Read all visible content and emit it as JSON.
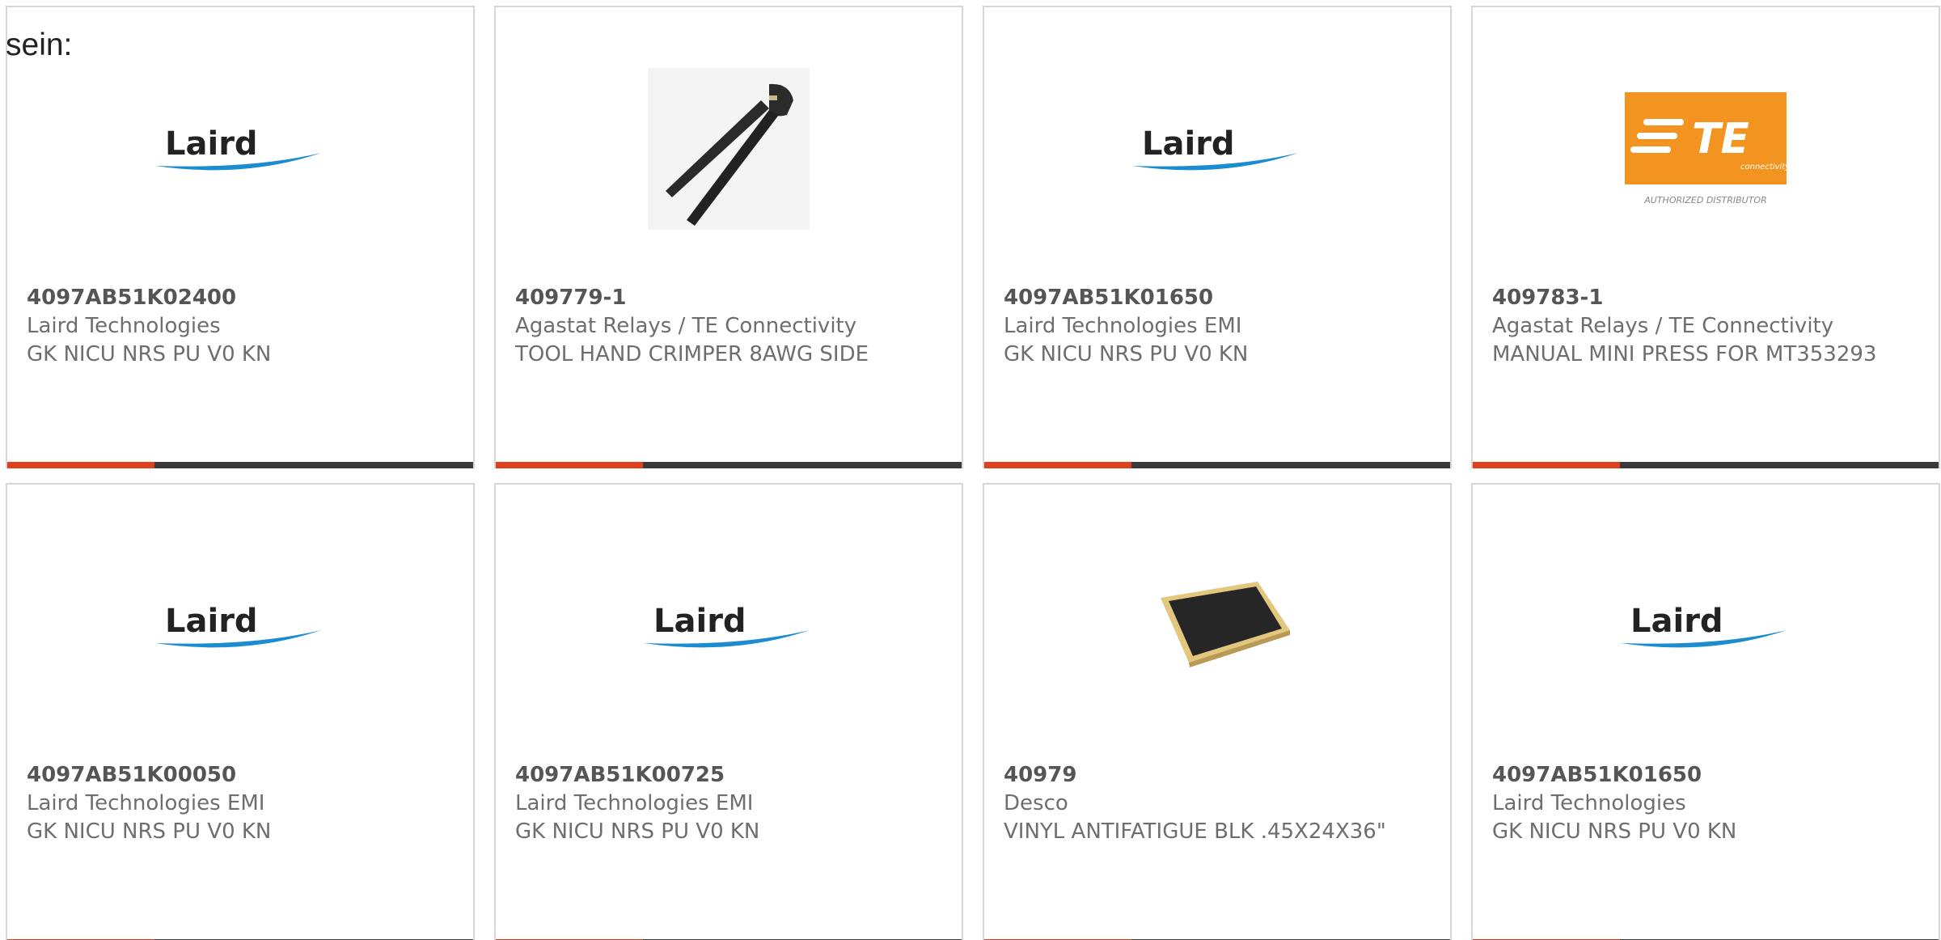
{
  "intro_text": "sein:",
  "colors": {
    "accent": "#e0401c",
    "bar": "#3a3a3a",
    "laird_blue": "#1a8ccf",
    "te_orange": "#f2941f"
  },
  "products": [
    {
      "part_number": "4097AB51K02400",
      "manufacturer": "Laird Technologies",
      "description": "GK NICU NRS PU V0 KN",
      "image": "laird-logo"
    },
    {
      "part_number": "409779-1",
      "manufacturer": "Agastat Relays / TE Connectivity",
      "description": "TOOL HAND CRIMPER 8AWG SIDE",
      "image": "hand-crimper"
    },
    {
      "part_number": "4097AB51K01650",
      "manufacturer": "Laird Technologies EMI",
      "description": "GK NICU NRS PU V0 KN",
      "image": "laird-logo"
    },
    {
      "part_number": "409783-1",
      "manufacturer": "Agastat Relays / TE Connectivity",
      "description": "MANUAL MINI PRESS FOR MT353293",
      "image": "te-connectivity-logo",
      "logo_text": "TE",
      "logo_subtext": "connectivity",
      "logo_caption": "AUTHORIZED DISTRIBUTOR"
    },
    {
      "part_number": "4097AB51K00050",
      "manufacturer": "Laird Technologies EMI",
      "description": "GK NICU NRS PU V0 KN",
      "image": "laird-logo"
    },
    {
      "part_number": "4097AB51K00725",
      "manufacturer": "Laird Technologies EMI",
      "description": "GK NICU NRS PU V0 KN",
      "image": "laird-logo"
    },
    {
      "part_number": "40979",
      "manufacturer": "Desco",
      "description": "VINYL ANTIFATIGUE BLK .45X24X36\"",
      "image": "antifatigue-mat"
    },
    {
      "part_number": "4097AB51K01650",
      "manufacturer": "Laird Technologies",
      "description": "GK NICU NRS PU V0 KN",
      "image": "laird-logo"
    }
  ],
  "laird_logo_text": "Laird"
}
